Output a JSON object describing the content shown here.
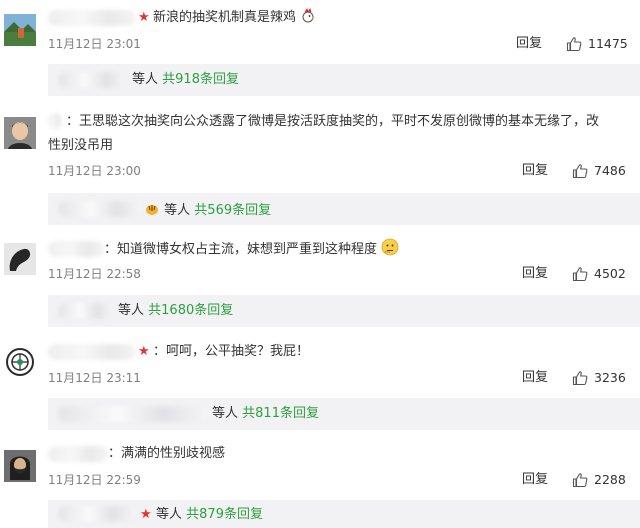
{
  "comments": [
    {
      "text": "新浪的抽奖机制真是辣鸡",
      "time": "11月12日 23:01",
      "reply_label": "回复",
      "likes": "11475",
      "others_label": "等人",
      "replies_count": "共918条回复",
      "avatar_icon": "landscape-avatar-icon",
      "emoji_icon": "rooster-emoji-icon"
    },
    {
      "text": "：王思聪这次抽奖向公众透露了微博是按活跃度抽奖的，平时不发原创微博的基本无缘了，改",
      "text_line2": "性别没吊用",
      "time": "11月12日 23:00",
      "reply_label": "回复",
      "likes": "7486",
      "others_label": "等人",
      "replies_count": "共569条回复",
      "avatar_icon": "man-avatar-icon"
    },
    {
      "text": "：知道微博女权占主流，妹想到严重到这种程度",
      "time": "11月12日 22:58",
      "reply_label": "回复",
      "likes": "4502",
      "others_label": "等人",
      "replies_count": "共1680条回复",
      "avatar_icon": "dark-object-avatar-icon",
      "emoji_icon": "thinking-emoji-icon"
    },
    {
      "text": "呵呵，公平抽奖？我屁！",
      "time": "11月12日 23:11",
      "reply_label": "回复",
      "likes": "3236",
      "others_label": "等人",
      "replies_count": "共811条回复",
      "avatar_icon": "badge-avatar-icon"
    },
    {
      "text": "：满满的性别歧视感",
      "time": "11月12日 22:59",
      "reply_label": "回复",
      "likes": "2288",
      "others_label": "等人",
      "replies_count": "共879条回复",
      "avatar_icon": "bearded-man-avatar-icon"
    }
  ],
  "colors": {
    "accent_green": "#2e9f3f",
    "star_red": "#e8332b",
    "reply_box_bg": "#f2f2f5",
    "time_gray": "#808080"
  }
}
